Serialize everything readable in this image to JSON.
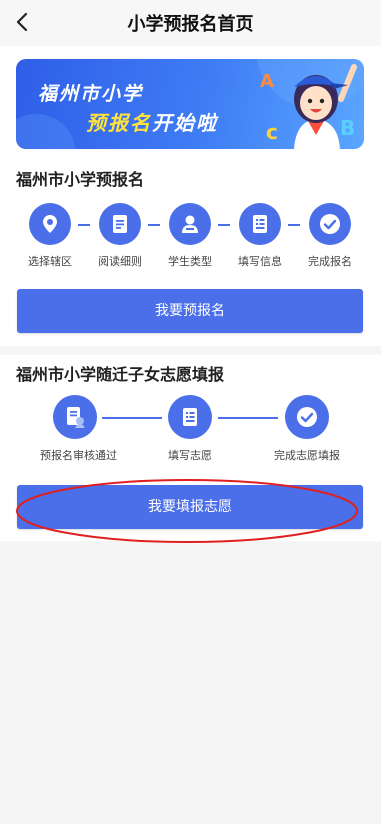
{
  "header": {
    "title": "小学预报名首页"
  },
  "banner": {
    "line1": "福州市小学",
    "line2_highlight": "预报名",
    "line2_rest": "开始啦"
  },
  "section1": {
    "title": "福州市小学预报名",
    "steps": [
      {
        "label": "选择辖区",
        "icon": "location-pin-icon"
      },
      {
        "label": "阅读细则",
        "icon": "document-icon"
      },
      {
        "label": "学生类型",
        "icon": "student-icon"
      },
      {
        "label": "填写信息",
        "icon": "form-icon"
      },
      {
        "label": "完成报名",
        "icon": "check-icon"
      }
    ],
    "button": "我要预报名"
  },
  "section2": {
    "title": "福州市小学随迁子女志愿填报",
    "steps": [
      {
        "label": "预报名审核通过",
        "icon": "review-icon"
      },
      {
        "label": "填写志愿",
        "icon": "form-icon"
      },
      {
        "label": "完成志愿填报",
        "icon": "check-icon"
      }
    ],
    "button": "我要填报志愿"
  },
  "colors": {
    "primary": "#4a6fe8",
    "highlight": "#ffe23b",
    "annotation": "#e02020"
  }
}
